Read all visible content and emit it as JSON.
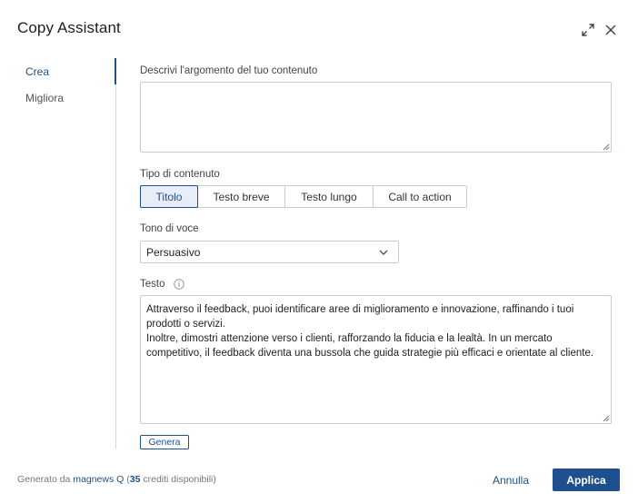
{
  "header": {
    "title": "Copy Assistant",
    "expand_icon": "expand-icon",
    "close_icon": "close-icon"
  },
  "sidebar": {
    "items": [
      {
        "label": "Crea",
        "active": true
      },
      {
        "label": "Migliora",
        "active": false
      }
    ]
  },
  "form": {
    "topic_label": "Descrivi l'argomento del tuo contenuto",
    "topic_value": "",
    "content_type_label": "Tipo di contenuto",
    "content_types": [
      {
        "label": "Titolo",
        "selected": true
      },
      {
        "label": "Testo breve",
        "selected": false
      },
      {
        "label": "Testo lungo",
        "selected": false
      },
      {
        "label": "Call to action",
        "selected": false
      }
    ],
    "tone_label": "Tono di voce",
    "tone_value": "Persuasivo",
    "text_label": "Testo",
    "text_value": "Attraverso il feedback, puoi identificare aree di miglioramento e innovazione, raffinando i tuoi prodotti o servizi.\nInoltre, dimostri attenzione verso i clienti, rafforzando la fiducia e la lealtà. In un mercato competitivo, il feedback diventa una bussola che guida strategie più efficaci e orientate al cliente.",
    "generate_label": "Genera"
  },
  "footer": {
    "generated_prefix": "Generato da ",
    "brand": "magnews Q",
    "open_paren": " (",
    "credits": "35",
    "credits_suffix": " crediti disponibili)",
    "cancel_label": "Annulla",
    "apply_label": "Applica"
  },
  "colors": {
    "accent": "#1e4f8f",
    "border": "#c9cdd3"
  }
}
